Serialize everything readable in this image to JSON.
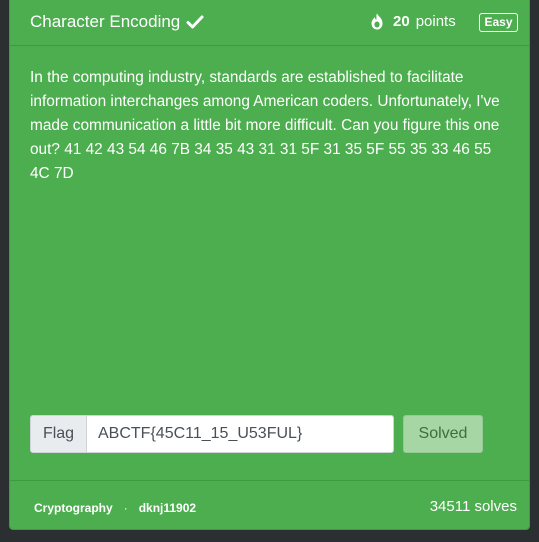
{
  "challenge": {
    "title": "Character Encoding",
    "points_value": "20",
    "points_label": "points",
    "difficulty": "Easy",
    "description": "In the computing industry, standards are established to facilitate information interchanges among American coders. Unfortunately, I've made communication a little bit more difficult. Can you figure this one out? 41 42 43 54 46 7B 34 35 43 31 31 5F 31 35 5F 55 35 33 46 55 4C 7D",
    "solved": true
  },
  "flag_form": {
    "addon_label": "Flag",
    "value": "ABCTF{45C11_15_U53FUL}",
    "submit_label": "Solved"
  },
  "footer": {
    "category": "Cryptography",
    "separator": "·",
    "author": "dknj11902",
    "solves": "34511 solves"
  },
  "colors": {
    "card_background": "#4cae4f",
    "page_background": "#2b2f32",
    "solved_button": "#a7d6a5"
  },
  "icons": {
    "title_status": "check-icon",
    "points": "flame-icon"
  }
}
